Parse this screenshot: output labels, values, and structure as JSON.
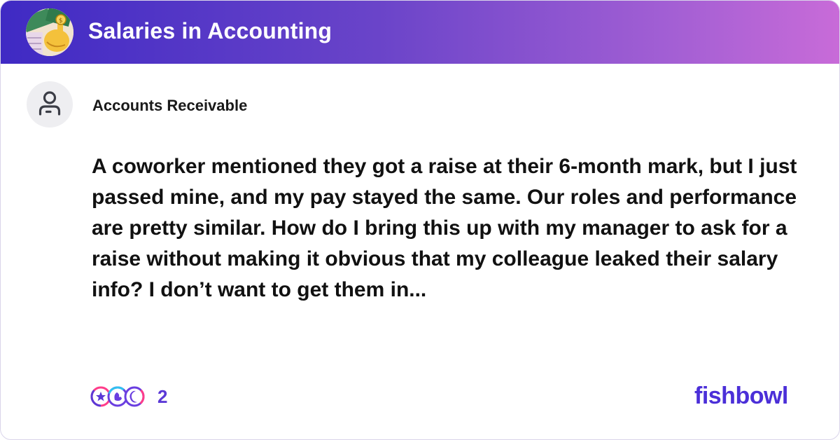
{
  "header": {
    "bowl_title": "Salaries in Accounting",
    "bowl_icon": "money-hand-emoji-icon",
    "gradient_colors": [
      "#3f2ac4",
      "#6a44c9",
      "#a35fd4",
      "#c86bd8"
    ]
  },
  "post": {
    "author_icon": "person-icon",
    "author": "Accounts Receivable",
    "text": "A coworker mentioned they got a raise at their 6-month mark, but I just passed mine, and my pay stayed the same. Our roles and performance are pretty similar. How do I bring this up with my manager to ask for a raise without making it obvious that my colleague leaked their salary info? I don’t want to get them in...",
    "reactions": {
      "icons": [
        "star-reaction-icon",
        "clap-reaction-icon",
        "moon-reaction-icon"
      ],
      "count": "2"
    }
  },
  "brand": {
    "name": "fishbowl",
    "color": "#4b2fd8"
  }
}
